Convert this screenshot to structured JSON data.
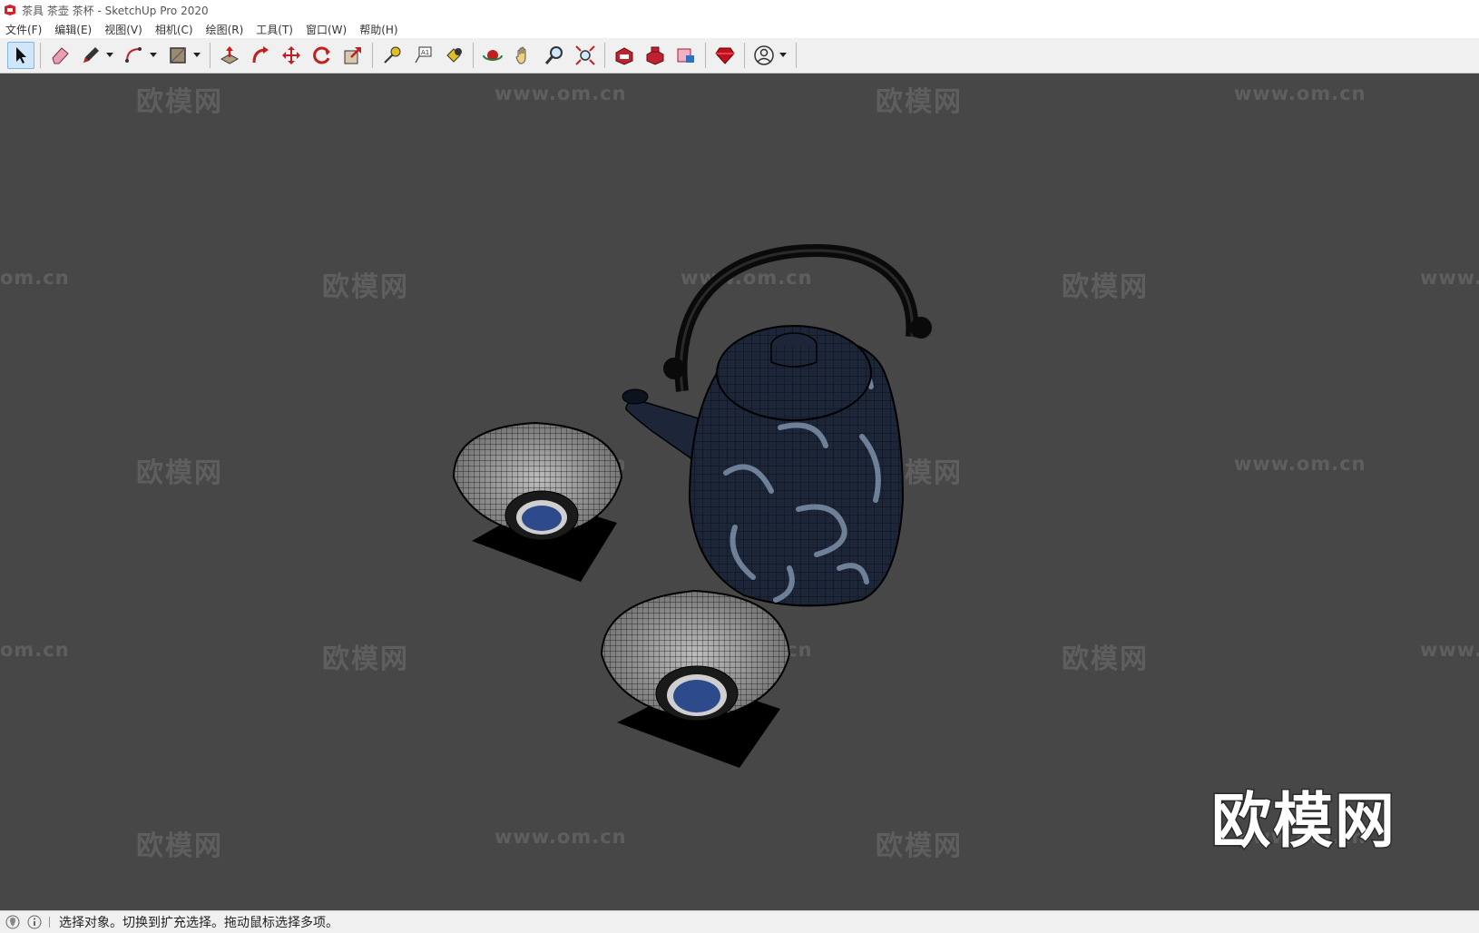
{
  "window": {
    "title": "茶具 茶壶 茶杯 - SketchUp Pro 2020"
  },
  "menu": [
    {
      "label": "文件(F)"
    },
    {
      "label": "编辑(E)"
    },
    {
      "label": "视图(V)"
    },
    {
      "label": "相机(C)"
    },
    {
      "label": "绘图(R)"
    },
    {
      "label": "工具(T)"
    },
    {
      "label": "窗口(W)"
    },
    {
      "label": "帮助(H)"
    }
  ],
  "toolbar": {
    "active_tool": "select",
    "tools": [
      "select-icon",
      "eraser-icon",
      "pencil-icon",
      "arc-icon",
      "rectangle-icon",
      "push-pull-icon",
      "follow-me-icon",
      "move-icon",
      "rotate-icon",
      "scale-icon",
      "tape-measure-icon",
      "text-icon",
      "paint-bucket-icon",
      "orbit-icon",
      "pan-icon",
      "zoom-icon",
      "zoom-extents-icon",
      "warehouse-icon",
      "extension-warehouse-icon",
      "layout-icon",
      "ruby-icon",
      "account-icon"
    ]
  },
  "watermark": {
    "cn_text": "欧模网",
    "url_text": "www.om.cn",
    "url_partial_left": "om.cn",
    "url_partial_right": "www.",
    "logo_text": "欧模网"
  },
  "status": {
    "message": "选择对象。切换到扩充选择。拖动鼠标选择多项。"
  },
  "colors": {
    "viewport_bg": "#474747",
    "teapot_body": "#1c2638",
    "teapot_pattern": "#8aa0b8",
    "cup_center": "#2d4a8a",
    "coaster": "#000000"
  }
}
